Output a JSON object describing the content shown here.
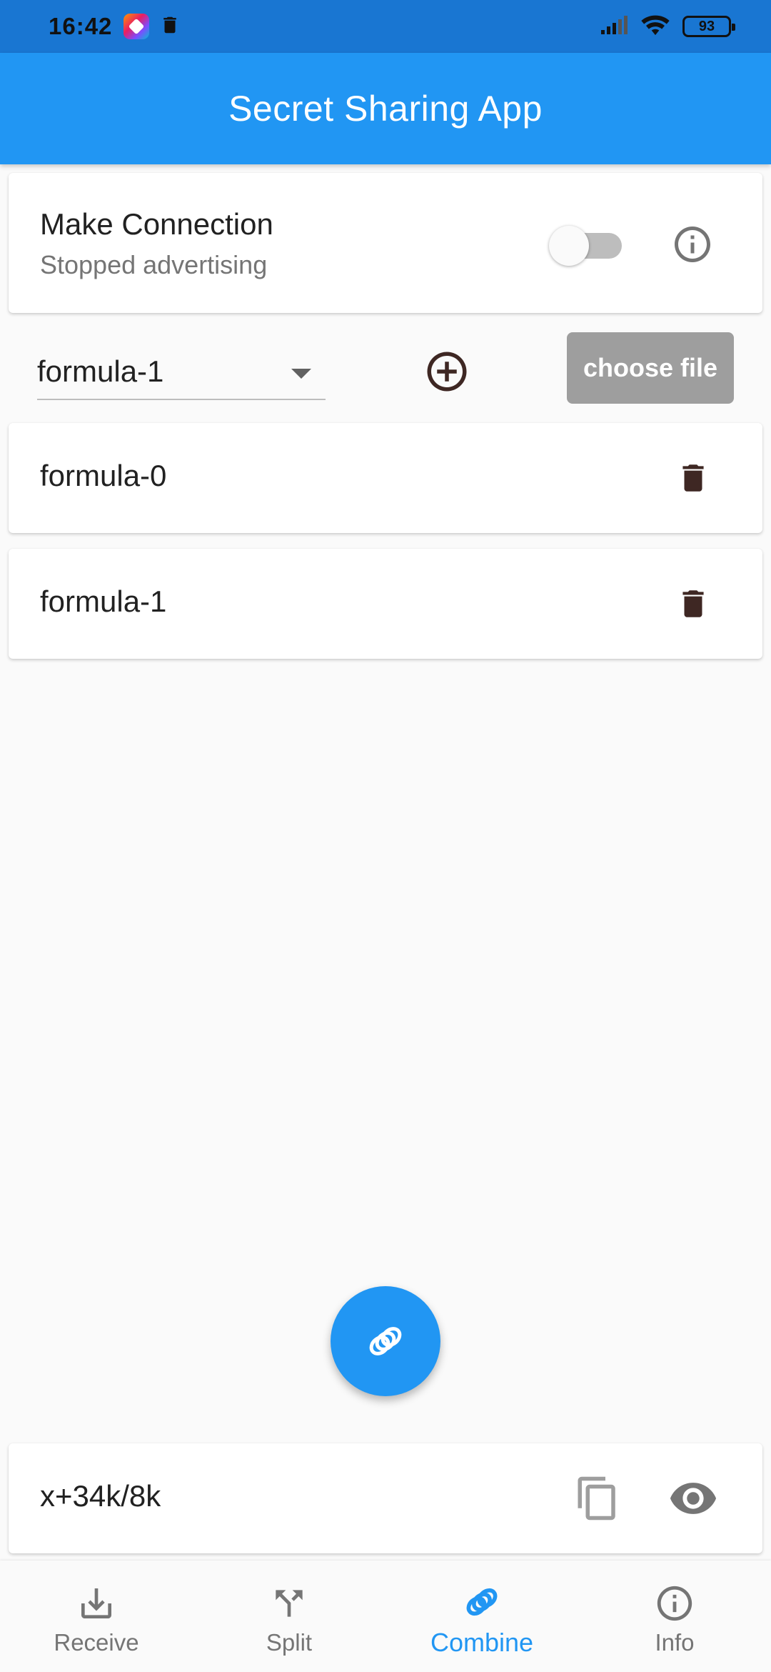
{
  "status_bar": {
    "time": "16:42",
    "battery": "93"
  },
  "app_bar": {
    "title": "Secret Sharing App"
  },
  "connection_card": {
    "title": "Make Connection",
    "subtitle": "Stopped advertising",
    "toggle_on": false
  },
  "selector": {
    "selected": "formula-1",
    "choose_file_label": "choose file"
  },
  "shares": [
    {
      "label": "formula-0"
    },
    {
      "label": "formula-1"
    }
  ],
  "result": {
    "value": "x+34k/8k"
  },
  "bottom_nav": {
    "items": [
      {
        "label": "Receive",
        "icon": "download-icon"
      },
      {
        "label": "Split",
        "icon": "split-icon"
      },
      {
        "label": "Combine",
        "icon": "combine-rings-icon",
        "active": true
      },
      {
        "label": "Info",
        "icon": "info-icon"
      }
    ]
  },
  "colors": {
    "primary": "#2196f3",
    "status_bar": "#1976d2",
    "icon_dark": "#3e2723",
    "inactive": "#757575",
    "disabled_button": "#9e9e9e"
  }
}
